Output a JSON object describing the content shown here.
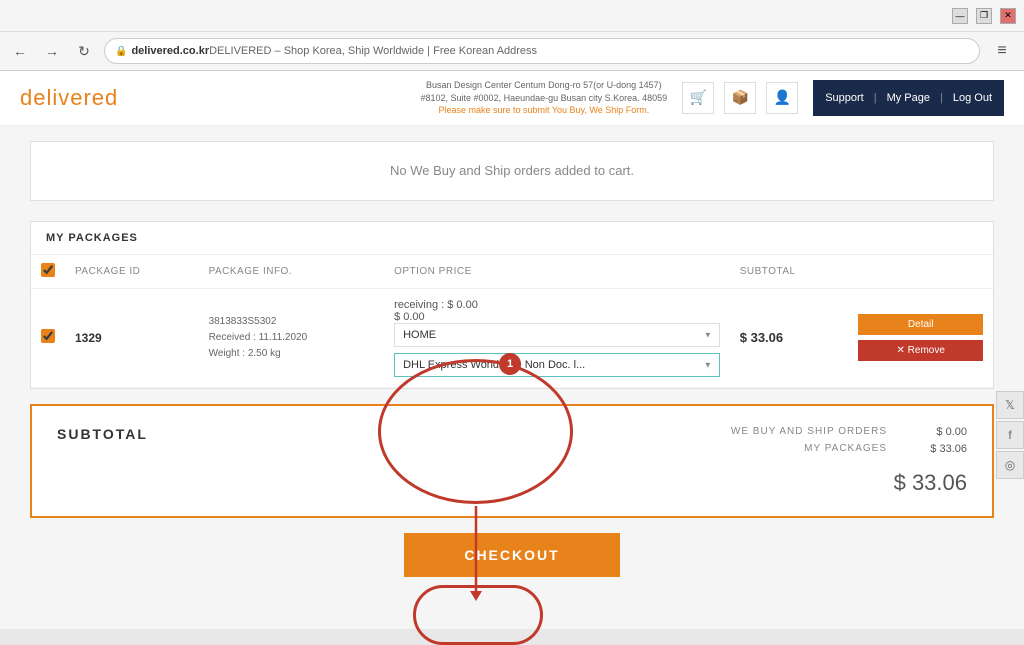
{
  "browser": {
    "url_domain": "delivered.co.kr",
    "url_title": " DELIVERED – Shop Korea, Ship Worldwide | Free Korean Address",
    "controls": {
      "minimize": "—",
      "maximize": "❐",
      "close": "✕"
    }
  },
  "header": {
    "logo": "delivered",
    "address_line1": "Busan Design Center Centum Dong-ro 57(or U-dong 1457)",
    "address_line2": "#8102, Suite #0002, Haeundae-gu Busan city S.Korea. 48059",
    "alert": "Please make sure to submit You Buy, We Ship Form.",
    "nav": {
      "support": "Support",
      "my_page": "My Page",
      "log_out": "Log Out"
    }
  },
  "cart": {
    "empty_message": "No We Buy and Ship orders added to cart."
  },
  "packages": {
    "section_title": "MY PACKAGES",
    "columns": {
      "checkbox": "",
      "package_id": "PACKAGE ID",
      "package_info": "PACKAGE INFO.",
      "option_price": "OPTION PRICE",
      "subtotal": "SUBTOTAL"
    },
    "row": {
      "id": "1329",
      "info_id": "3813833S5302",
      "received": "Received : 11.11.2020",
      "weight": "Weight : 2.50 kg",
      "receiving_label": "receiving : $ 0.00",
      "price": "$ 0.00",
      "dropdown1_value": "HOME",
      "dropdown2_value": "DHL Express W",
      "dropdown2_extra": "orldwide Non Doc. l...",
      "subtotal": "$ 33.06",
      "btn_detail": "Detail",
      "btn_remove": "✕ Remove"
    }
  },
  "subtotal_section": {
    "title": "SUBTOTAL",
    "we_buy_label": "WE BUY AND SHIP ORDERS",
    "we_buy_value": "$ 0.00",
    "my_packages_label": "MY PACKAGES",
    "my_packages_value": "$ 33.06",
    "total": "$ 33.06"
  },
  "checkout": {
    "button_label": "CHECKOUT"
  },
  "annotation": {
    "badge": "1"
  },
  "social": {
    "twitter": "𝕏",
    "facebook": "f",
    "instagram": "◎"
  }
}
